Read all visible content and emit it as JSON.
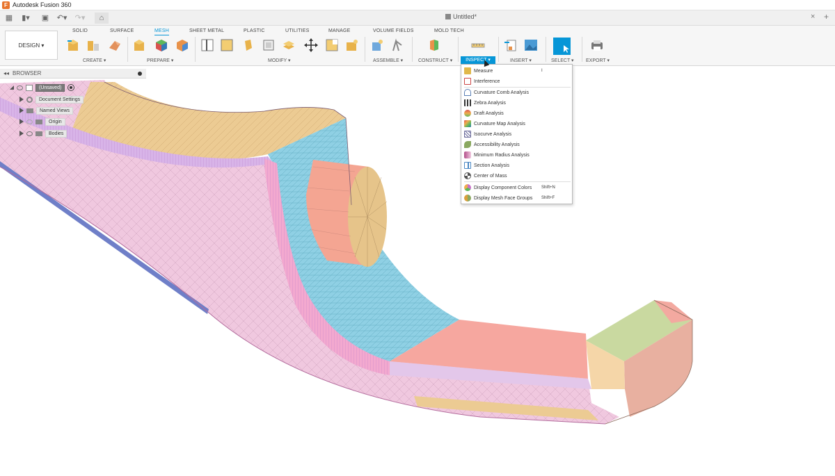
{
  "app": {
    "title": "Autodesk Fusion 360",
    "logo_letter": "F"
  },
  "quick_access": {
    "grid_icon": "grid-icon",
    "file_icon": "file-icon",
    "save_icon": "save-icon",
    "undo_icon": "undo-icon",
    "redo_icon": "redo-icon",
    "home_icon": "home-icon"
  },
  "document": {
    "tab_title": "Untitled*",
    "close_symbol": "×",
    "add_symbol": "+"
  },
  "workspace": {
    "label": "DESIGN ▾"
  },
  "ribbon_tabs": [
    "SOLID",
    "SURFACE",
    "MESH",
    "SHEET METAL",
    "PLASTIC",
    "UTILITIES",
    "MANAGE",
    "VOLUME FIELDS",
    "MOLD TECH"
  ],
  "active_tab": "MESH",
  "groups": {
    "create": "CREATE ▾",
    "prepare": "PREPARE ▾",
    "modify": "MODIFY ▾",
    "assemble": "ASSEMBLE ▾",
    "construct": "CONSTRUCT ▾",
    "inspect": "INSPECT ▾",
    "insert": "INSERT ▾",
    "select": "SELECT ▾",
    "export": "EXPORT ▾"
  },
  "browser": {
    "title": "BROWSER",
    "collapse_symbol": "◂◂",
    "items": [
      {
        "label": "(Unsaved)"
      },
      {
        "label": "Document Settings"
      },
      {
        "label": "Named Views"
      },
      {
        "label": "Origin"
      },
      {
        "label": "Bodies"
      }
    ]
  },
  "inspect_menu": {
    "items": [
      {
        "label": "Measure",
        "shortcut": "I",
        "icon": "measure-icon",
        "color": "#e0b84a"
      },
      {
        "label": "Interference",
        "shortcut": "",
        "icon": "interference-icon",
        "color": "#c44"
      },
      {
        "label": "Curvature Comb Analysis",
        "shortcut": "",
        "icon": "curvature-comb-icon",
        "color": "#5a7fb5"
      },
      {
        "label": "Zebra Analysis",
        "shortcut": "",
        "icon": "zebra-icon",
        "color": "#333"
      },
      {
        "label": "Draft Analysis",
        "shortcut": "",
        "icon": "draft-icon",
        "color": "#d96a3c"
      },
      {
        "label": "Curvature Map Analysis",
        "shortcut": "",
        "icon": "curvature-map-icon",
        "color": "#3cae5a"
      },
      {
        "label": "Isocurve Analysis",
        "shortcut": "",
        "icon": "isocurve-icon",
        "color": "#6b6b9a"
      },
      {
        "label": "Accessibility Analysis",
        "shortcut": "",
        "icon": "accessibility-icon",
        "color": "#8aa860"
      },
      {
        "label": "Minimum Radius Analysis",
        "shortcut": "",
        "icon": "minimum-radius-icon",
        "color": "#b3508a"
      },
      {
        "label": "Section Analysis",
        "shortcut": "",
        "icon": "section-icon",
        "color": "#4c88c4"
      },
      {
        "label": "Center of Mass",
        "shortcut": "",
        "icon": "center-of-mass-icon",
        "color": "#555"
      },
      {
        "label": "Display Component Colors",
        "shortcut": "Shift+N",
        "icon": "component-colors-icon",
        "color": "#c96fc9"
      },
      {
        "label": "Display Mesh Face Groups",
        "shortcut": "Shift+F",
        "icon": "face-groups-icon",
        "color": "#d9a03c"
      }
    ]
  },
  "colors": {
    "accent": "#0696d7",
    "face_pink": "#f0c8df",
    "face_tan": "#eccb93",
    "face_blue": "#8fd0e4",
    "face_salmon": "#f6a79f",
    "face_green": "#c9d9a0",
    "face_lilac": "#d8b4e8",
    "face_bluestrip": "#6f7fc8"
  }
}
